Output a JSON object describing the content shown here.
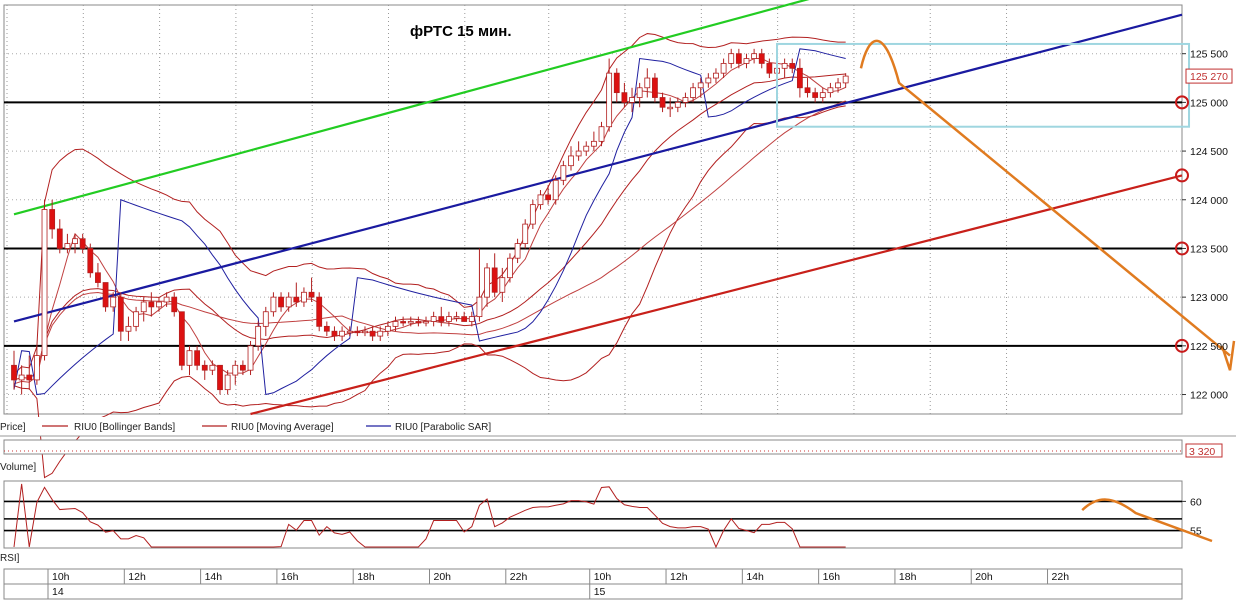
{
  "chart_data": {
    "type": "candlestick",
    "title": "фРТС   15 мин.",
    "price_panel": {
      "ylim": [
        121800,
        126000
      ],
      "y_ticks": [
        "125 500",
        "125 000",
        "124 500",
        "124 000",
        "123 500",
        "123 000",
        "122 500",
        "122 000"
      ],
      "last_price_label": "125 270",
      "candles": [
        {
          "o": 122300,
          "h": 122450,
          "l": 122050,
          "c": 122150,
          "color": "red"
        },
        {
          "o": 122150,
          "h": 122300,
          "l": 122000,
          "c": 122200,
          "color": "white"
        },
        {
          "o": 122200,
          "h": 122400,
          "l": 122050,
          "c": 122150,
          "color": "red"
        },
        {
          "o": 122150,
          "h": 122500,
          "l": 122100,
          "c": 122400,
          "color": "white"
        },
        {
          "o": 122400,
          "h": 124000,
          "l": 122350,
          "c": 123900,
          "color": "white"
        },
        {
          "o": 123900,
          "h": 124000,
          "l": 123600,
          "c": 123700,
          "color": "red"
        },
        {
          "o": 123700,
          "h": 123800,
          "l": 123450,
          "c": 123500,
          "color": "red"
        },
        {
          "o": 123500,
          "h": 123650,
          "l": 123450,
          "c": 123550,
          "color": "white"
        },
        {
          "o": 123550,
          "h": 123650,
          "l": 123450,
          "c": 123600,
          "color": "white"
        },
        {
          "o": 123600,
          "h": 123650,
          "l": 123450,
          "c": 123500,
          "color": "red"
        },
        {
          "o": 123500,
          "h": 123550,
          "l": 123200,
          "c": 123250,
          "color": "red"
        },
        {
          "o": 123250,
          "h": 123350,
          "l": 123100,
          "c": 123150,
          "color": "red"
        },
        {
          "o": 123150,
          "h": 123150,
          "l": 122850,
          "c": 122900,
          "color": "red"
        },
        {
          "o": 122900,
          "h": 123050,
          "l": 122850,
          "c": 123000,
          "color": "white"
        },
        {
          "o": 123000,
          "h": 123050,
          "l": 122550,
          "c": 122650,
          "color": "red"
        },
        {
          "o": 122650,
          "h": 122800,
          "l": 122550,
          "c": 122700,
          "color": "white"
        },
        {
          "o": 122700,
          "h": 122900,
          "l": 122650,
          "c": 122850,
          "color": "white"
        },
        {
          "o": 122850,
          "h": 123000,
          "l": 122750,
          "c": 122950,
          "color": "white"
        },
        {
          "o": 122950,
          "h": 123050,
          "l": 122800,
          "c": 122900,
          "color": "red"
        },
        {
          "o": 122900,
          "h": 123000,
          "l": 122850,
          "c": 122950,
          "color": "white"
        },
        {
          "o": 122950,
          "h": 123050,
          "l": 122900,
          "c": 123000,
          "color": "white"
        },
        {
          "o": 123000,
          "h": 123050,
          "l": 122800,
          "c": 122850,
          "color": "red"
        },
        {
          "o": 122850,
          "h": 122850,
          "l": 122250,
          "c": 122300,
          "color": "red"
        },
        {
          "o": 122300,
          "h": 122500,
          "l": 122200,
          "c": 122450,
          "color": "white"
        },
        {
          "o": 122450,
          "h": 122500,
          "l": 122250,
          "c": 122300,
          "color": "red"
        },
        {
          "o": 122300,
          "h": 122350,
          "l": 122150,
          "c": 122250,
          "color": "red"
        },
        {
          "o": 122250,
          "h": 122350,
          "l": 122200,
          "c": 122300,
          "color": "white"
        },
        {
          "o": 122300,
          "h": 122300,
          "l": 122000,
          "c": 122050,
          "color": "red"
        },
        {
          "o": 122050,
          "h": 122250,
          "l": 122000,
          "c": 122200,
          "color": "white"
        },
        {
          "o": 122200,
          "h": 122350,
          "l": 122100,
          "c": 122300,
          "color": "white"
        },
        {
          "o": 122300,
          "h": 122350,
          "l": 122200,
          "c": 122250,
          "color": "red"
        },
        {
          "o": 122250,
          "h": 122550,
          "l": 122200,
          "c": 122500,
          "color": "white"
        },
        {
          "o": 122500,
          "h": 122750,
          "l": 122450,
          "c": 122700,
          "color": "white"
        },
        {
          "o": 122700,
          "h": 122900,
          "l": 122600,
          "c": 122850,
          "color": "white"
        },
        {
          "o": 122850,
          "h": 123050,
          "l": 122800,
          "c": 123000,
          "color": "white"
        },
        {
          "o": 123000,
          "h": 123050,
          "l": 122850,
          "c": 122900,
          "color": "red"
        },
        {
          "o": 122900,
          "h": 123050,
          "l": 122850,
          "c": 123000,
          "color": "white"
        },
        {
          "o": 123000,
          "h": 123150,
          "l": 122900,
          "c": 122950,
          "color": "red"
        },
        {
          "o": 122950,
          "h": 123100,
          "l": 122900,
          "c": 123050,
          "color": "white"
        },
        {
          "o": 123050,
          "h": 123200,
          "l": 122950,
          "c": 123000,
          "color": "red"
        },
        {
          "o": 123000,
          "h": 123050,
          "l": 122650,
          "c": 122700,
          "color": "red"
        },
        {
          "o": 122700,
          "h": 122750,
          "l": 122600,
          "c": 122650,
          "color": "red"
        },
        {
          "o": 122650,
          "h": 122700,
          "l": 122550,
          "c": 122600,
          "color": "red"
        },
        {
          "o": 122600,
          "h": 122700,
          "l": 122550,
          "c": 122650,
          "color": "white"
        },
        {
          "o": 122650,
          "h": 122700,
          "l": 122600,
          "c": 122650,
          "color": "white"
        },
        {
          "o": 122650,
          "h": 122700,
          "l": 122600,
          "c": 122650,
          "color": "red"
        },
        {
          "o": 122650,
          "h": 122700,
          "l": 122600,
          "c": 122650,
          "color": "white"
        },
        {
          "o": 122650,
          "h": 122700,
          "l": 122550,
          "c": 122600,
          "color": "red"
        },
        {
          "o": 122600,
          "h": 122700,
          "l": 122550,
          "c": 122650,
          "color": "white"
        },
        {
          "o": 122650,
          "h": 122750,
          "l": 122600,
          "c": 122700,
          "color": "white"
        },
        {
          "o": 122700,
          "h": 122800,
          "l": 122650,
          "c": 122750,
          "color": "white"
        },
        {
          "o": 122750,
          "h": 122800,
          "l": 122700,
          "c": 122750,
          "color": "red"
        },
        {
          "o": 122750,
          "h": 122800,
          "l": 122700,
          "c": 122750,
          "color": "white"
        },
        {
          "o": 122750,
          "h": 122800,
          "l": 122700,
          "c": 122750,
          "color": "red"
        },
        {
          "o": 122750,
          "h": 122800,
          "l": 122700,
          "c": 122750,
          "color": "white"
        },
        {
          "o": 122750,
          "h": 122850,
          "l": 122700,
          "c": 122800,
          "color": "white"
        },
        {
          "o": 122800,
          "h": 122900,
          "l": 122700,
          "c": 122750,
          "color": "red"
        },
        {
          "o": 122750,
          "h": 122850,
          "l": 122700,
          "c": 122800,
          "color": "white"
        },
        {
          "o": 122800,
          "h": 122850,
          "l": 122750,
          "c": 122800,
          "color": "white"
        },
        {
          "o": 122800,
          "h": 122850,
          "l": 122750,
          "c": 122750,
          "color": "red"
        },
        {
          "o": 122750,
          "h": 122850,
          "l": 122700,
          "c": 122800,
          "color": "white"
        },
        {
          "o": 122800,
          "h": 123500,
          "l": 122750,
          "c": 123000,
          "color": "white"
        },
        {
          "o": 123000,
          "h": 123350,
          "l": 122900,
          "c": 123300,
          "color": "white"
        },
        {
          "o": 123300,
          "h": 123450,
          "l": 123000,
          "c": 123050,
          "color": "red"
        },
        {
          "o": 123050,
          "h": 123300,
          "l": 122950,
          "c": 123200,
          "color": "white"
        },
        {
          "o": 123200,
          "h": 123450,
          "l": 123150,
          "c": 123400,
          "color": "white"
        },
        {
          "o": 123400,
          "h": 123600,
          "l": 123350,
          "c": 123550,
          "color": "white"
        },
        {
          "o": 123550,
          "h": 123800,
          "l": 123500,
          "c": 123750,
          "color": "white"
        },
        {
          "o": 123750,
          "h": 124000,
          "l": 123700,
          "c": 123950,
          "color": "white"
        },
        {
          "o": 123950,
          "h": 124100,
          "l": 123900,
          "c": 124050,
          "color": "white"
        },
        {
          "o": 124050,
          "h": 124150,
          "l": 123950,
          "c": 124000,
          "color": "red"
        },
        {
          "o": 124000,
          "h": 124250,
          "l": 123950,
          "c": 124200,
          "color": "white"
        },
        {
          "o": 124200,
          "h": 124400,
          "l": 124150,
          "c": 124350,
          "color": "white"
        },
        {
          "o": 124350,
          "h": 124550,
          "l": 124300,
          "c": 124450,
          "color": "white"
        },
        {
          "o": 124450,
          "h": 124600,
          "l": 124400,
          "c": 124500,
          "color": "white"
        },
        {
          "o": 124500,
          "h": 124600,
          "l": 124450,
          "c": 124550,
          "color": "white"
        },
        {
          "o": 124550,
          "h": 124700,
          "l": 124500,
          "c": 124600,
          "color": "white"
        },
        {
          "o": 124600,
          "h": 124800,
          "l": 124550,
          "c": 124750,
          "color": "white"
        },
        {
          "o": 124750,
          "h": 125450,
          "l": 124700,
          "c": 125300,
          "color": "white"
        },
        {
          "o": 125300,
          "h": 125350,
          "l": 125000,
          "c": 125100,
          "color": "red"
        },
        {
          "o": 125100,
          "h": 125200,
          "l": 124950,
          "c": 125000,
          "color": "red"
        },
        {
          "o": 125000,
          "h": 125150,
          "l": 124900,
          "c": 125050,
          "color": "white"
        },
        {
          "o": 125050,
          "h": 125200,
          "l": 124950,
          "c": 125150,
          "color": "white"
        },
        {
          "o": 125150,
          "h": 125350,
          "l": 125050,
          "c": 125250,
          "color": "white"
        },
        {
          "o": 125250,
          "h": 125300,
          "l": 125000,
          "c": 125050,
          "color": "red"
        },
        {
          "o": 125050,
          "h": 125100,
          "l": 124900,
          "c": 124950,
          "color": "red"
        },
        {
          "o": 124950,
          "h": 125050,
          "l": 124850,
          "c": 124950,
          "color": "white"
        },
        {
          "o": 124950,
          "h": 125050,
          "l": 124900,
          "c": 125000,
          "color": "white"
        },
        {
          "o": 125000,
          "h": 125100,
          "l": 124950,
          "c": 125050,
          "color": "white"
        },
        {
          "o": 125050,
          "h": 125200,
          "l": 125000,
          "c": 125150,
          "color": "white"
        },
        {
          "o": 125150,
          "h": 125250,
          "l": 125050,
          "c": 125200,
          "color": "white"
        },
        {
          "o": 125200,
          "h": 125300,
          "l": 125150,
          "c": 125250,
          "color": "white"
        },
        {
          "o": 125250,
          "h": 125350,
          "l": 125200,
          "c": 125300,
          "color": "white"
        },
        {
          "o": 125300,
          "h": 125450,
          "l": 125250,
          "c": 125400,
          "color": "white"
        },
        {
          "o": 125400,
          "h": 125550,
          "l": 125350,
          "c": 125500,
          "color": "white"
        },
        {
          "o": 125500,
          "h": 125550,
          "l": 125350,
          "c": 125400,
          "color": "red"
        },
        {
          "o": 125400,
          "h": 125500,
          "l": 125350,
          "c": 125450,
          "color": "white"
        },
        {
          "o": 125450,
          "h": 125550,
          "l": 125400,
          "c": 125500,
          "color": "white"
        },
        {
          "o": 125500,
          "h": 125550,
          "l": 125350,
          "c": 125400,
          "color": "red"
        },
        {
          "o": 125400,
          "h": 125450,
          "l": 125250,
          "c": 125300,
          "color": "red"
        },
        {
          "o": 125300,
          "h": 125400,
          "l": 125200,
          "c": 125350,
          "color": "white"
        },
        {
          "o": 125350,
          "h": 125450,
          "l": 125250,
          "c": 125400,
          "color": "white"
        },
        {
          "o": 125400,
          "h": 125450,
          "l": 125300,
          "c": 125350,
          "color": "red"
        },
        {
          "o": 125350,
          "h": 125450,
          "l": 125050,
          "c": 125150,
          "color": "red"
        },
        {
          "o": 125150,
          "h": 125250,
          "l": 125050,
          "c": 125100,
          "color": "red"
        },
        {
          "o": 125100,
          "h": 125150,
          "l": 125000,
          "c": 125050,
          "color": "red"
        },
        {
          "o": 125050,
          "h": 125150,
          "l": 125000,
          "c": 125100,
          "color": "white"
        },
        {
          "o": 125100,
          "h": 125200,
          "l": 125050,
          "c": 125150,
          "color": "white"
        },
        {
          "o": 125150,
          "h": 125250,
          "l": 125100,
          "c": 125200,
          "color": "white"
        },
        {
          "o": 125200,
          "h": 125300,
          "l": 125150,
          "c": 125270,
          "color": "white"
        }
      ],
      "horizontal_levels": [
        125000,
        123500,
        122500
      ],
      "trend_lines": [
        {
          "name": "green",
          "color": "#22cc22",
          "from": [
            0,
            123850
          ],
          "to": [
            106,
            126100
          ]
        },
        {
          "name": "blue",
          "color": "#1a1aa0",
          "from": [
            0,
            122750
          ],
          "to": [
            160,
            125900
          ]
        },
        {
          "name": "red",
          "color": "#c8201a",
          "from": [
            31,
            121800
          ],
          "to": [
            160,
            124250
          ]
        }
      ],
      "box": {
        "color": "#9fd6e0",
        "from": [
          100,
          125600
        ],
        "to": [
          154,
          124750
        ]
      },
      "forecast_markers": [
        125000,
        124250,
        123500,
        122500
      ]
    },
    "legend": [
      "Price]",
      "RIU0 [Bollinger Bands]",
      "RIU0 [Moving Average]",
      "RIU0 [Parabolic SAR]"
    ],
    "volume_panel": {
      "label": "Volume]",
      "last_value_label": "3 320"
    },
    "rsi_panel": {
      "label": "RSI]",
      "y_ticks": [
        "60",
        "55"
      ],
      "levels": [
        60,
        57,
        55
      ],
      "ylim": [
        52,
        63.5
      ]
    },
    "x_axis": {
      "ticks": [
        {
          "label": "10h",
          "i": 0
        },
        {
          "label": "12h",
          "i": 10
        },
        {
          "label": "14h",
          "i": 20
        },
        {
          "label": "16h",
          "i": 30
        },
        {
          "label": "18h",
          "i": 40
        },
        {
          "label": "20h",
          "i": 50
        },
        {
          "label": "22h",
          "i": 60
        },
        {
          "label": "10h",
          "i": 71
        },
        {
          "label": "12h",
          "i": 81
        },
        {
          "label": "14h",
          "i": 91
        },
        {
          "label": "16h",
          "i": 101
        },
        {
          "label": "18h",
          "i": 111
        },
        {
          "label": "20h",
          "i": 121
        },
        {
          "label": "22h",
          "i": 131
        }
      ],
      "days": [
        {
          "label": "14",
          "i": 0
        },
        {
          "label": "15",
          "i": 71
        }
      ]
    }
  }
}
